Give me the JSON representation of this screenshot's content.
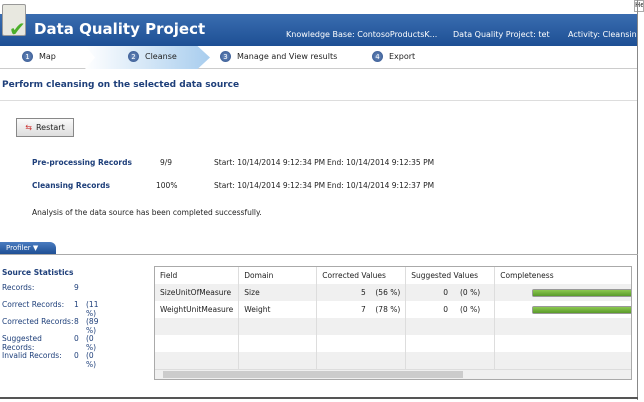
{
  "header": {
    "title": "Data Quality Project",
    "knowledge_base": "Knowledge Base: ContosoProductsK...",
    "project": "Data Quality Project: tet",
    "activity": "Activity: Cleansing",
    "help": "Help"
  },
  "steps": [
    {
      "num": "1",
      "label": "Map"
    },
    {
      "num": "2",
      "label": "Cleanse",
      "active": true
    },
    {
      "num": "3",
      "label": "Manage and View results"
    },
    {
      "num": "4",
      "label": "Export"
    }
  ],
  "page": {
    "heading": "Perform cleansing on the selected data source",
    "restart": "Restart",
    "progress": [
      {
        "label": "Pre-processing Records",
        "value": "9/9",
        "start": "Start: 10/14/2014 9:12:34 PM",
        "end": "End: 10/14/2014 9:12:35 PM"
      },
      {
        "label": "Cleansing Records",
        "value": "100%",
        "start": "Start: 10/14/2014 9:12:34 PM",
        "end": "End: 10/14/2014 9:12:37 PM"
      }
    ],
    "message": "Analysis of the data source has been completed successfully."
  },
  "profiler": {
    "tab": "Profiler ▼",
    "stats_title": "Source Statistics",
    "stats": [
      {
        "label": "Records:",
        "count": "9",
        "pct": ""
      },
      {
        "label": "Correct Records:",
        "count": "1",
        "pct": "(11 %)"
      },
      {
        "label": "Corrected Records:",
        "count": "8",
        "pct": "(89 %)"
      },
      {
        "label": "Suggested Records:",
        "count": "0",
        "pct": "(0 %)"
      },
      {
        "label": "Invalid Records:",
        "count": "0",
        "pct": "(0 %)"
      }
    ],
    "columns": [
      "Field",
      "Domain",
      "Corrected Values",
      "Suggested Values",
      "Completeness"
    ],
    "rows": [
      {
        "field": "SizeUnitOfMeasure",
        "domain": "Size",
        "corrected": "5",
        "corrected_pct": "(56 %)",
        "suggested": "0",
        "suggested_pct": "(0 %)",
        "completeness": 100
      },
      {
        "field": "WeightUnitMeasure",
        "domain": "Weight",
        "corrected": "7",
        "corrected_pct": "(78 %)",
        "suggested": "0",
        "suggested_pct": "(0 %)",
        "completeness": 100
      }
    ]
  },
  "colors": {
    "header": "#1d4f94",
    "accent": "#1e3f7a",
    "bar": "#6aaa35"
  }
}
